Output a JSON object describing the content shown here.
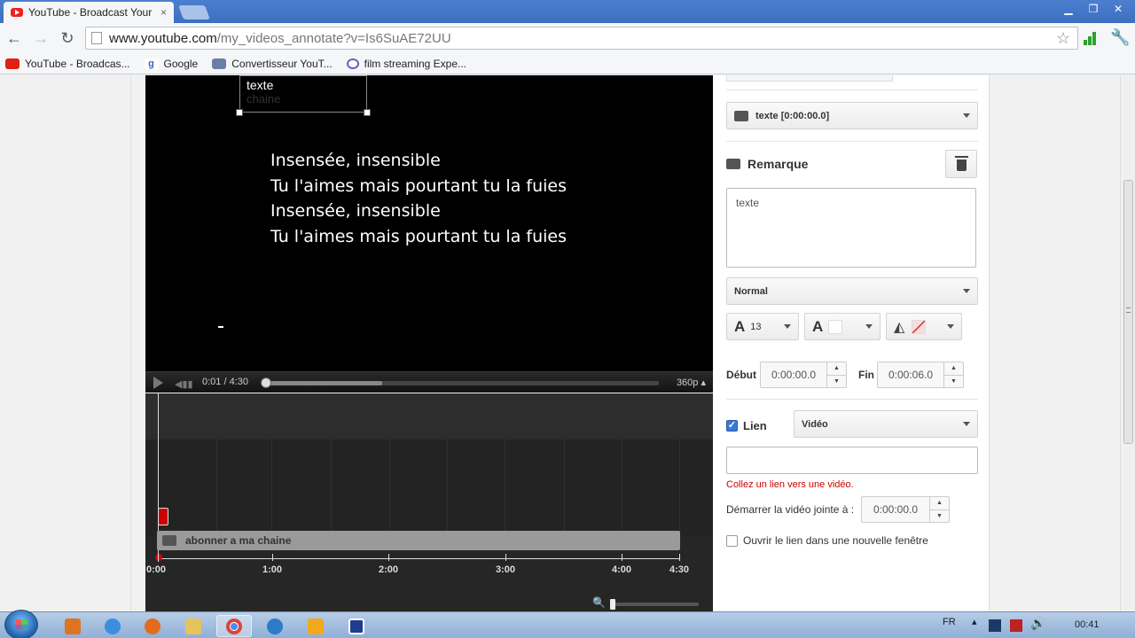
{
  "browser": {
    "tab_title": "YouTube - Broadcast Your",
    "tab_close": "×",
    "url_host": "www.youtube.com",
    "url_path": "/my_videos_annotate?v=Is6SuAE72UU",
    "bookmarks": [
      {
        "label": "YouTube - Broadcas...",
        "icon": "youtube-icon"
      },
      {
        "label": "Google",
        "icon": "google-icon"
      },
      {
        "label": "Convertisseur YouT...",
        "icon": "converter-icon"
      },
      {
        "label": "film streaming Expe...",
        "icon": "film-streaming-icon"
      }
    ]
  },
  "video": {
    "annotation_text": "texte",
    "annotation_ghost": "chaine",
    "lyrics": [
      "Insensée, insensible",
      "Tu l'aimes mais pourtant tu la fuies",
      "Insensée, insensible",
      "Tu l'aimes mais pourtant tu la fuies"
    ]
  },
  "player": {
    "time": "0:01 / 4:30",
    "quality": "360p",
    "buffered_fraction": 0.3
  },
  "timeline": {
    "annotation_label": "abonner a ma chaine",
    "ticks": [
      "0:00",
      "1:00",
      "2:00",
      "3:00",
      "4:00",
      "4:30"
    ]
  },
  "editor": {
    "type_select": "texte [0:00:00.0]",
    "section_title": "Remarque",
    "text_value": "texte",
    "size_select": "Normal",
    "font_size": "13",
    "start_label": "Début",
    "start_value": "0:00:00.0",
    "end_label": "Fin",
    "end_value": "0:00:06.0",
    "link_label": "Lien",
    "link_checked": true,
    "link_type": "Vidéo",
    "link_input": "",
    "link_hint": "Collez un lien vers une vidéo.",
    "start_video_label": "Démarrer la vidéo jointe à :",
    "start_video_value": "0:00:00.0",
    "new_window_label": "Ouvrir le lien dans une nouvelle fenêtre"
  },
  "taskbar": {
    "language": "FR",
    "clock": "00:41"
  },
  "colors": {
    "accent_red": "#cc0000",
    "link_blue": "#3a78d4"
  }
}
